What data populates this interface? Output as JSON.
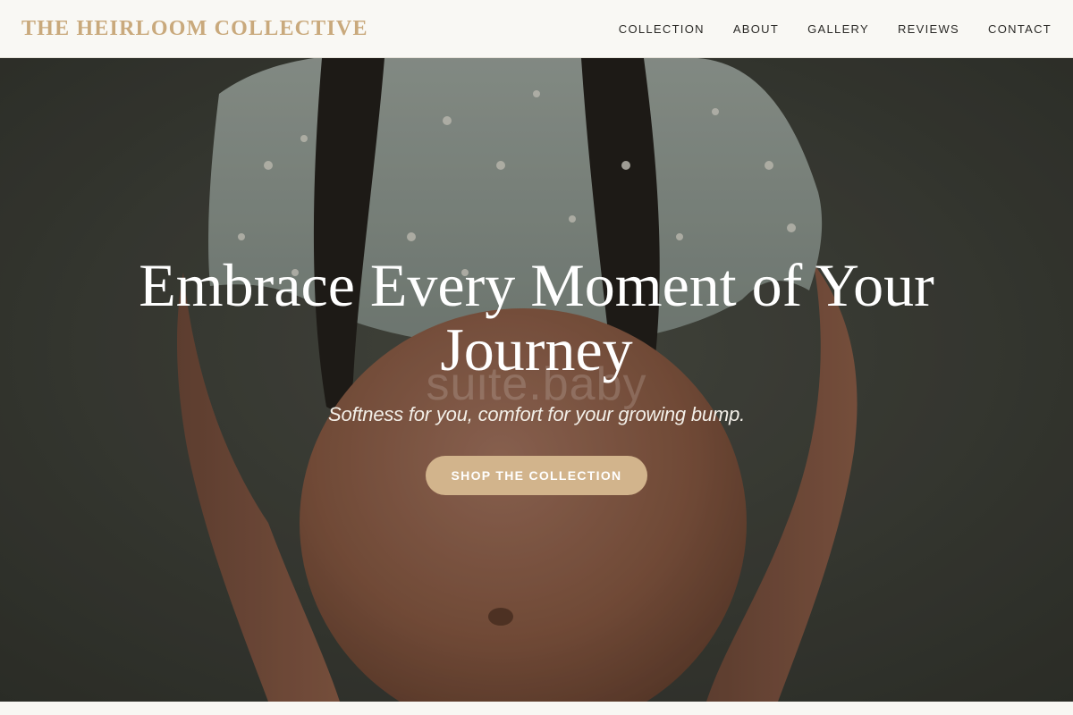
{
  "brand": {
    "name": "THE HEIRLOOM COLLECTIVE",
    "accent_color": "#c9a97c"
  },
  "nav": {
    "items": [
      {
        "label": "COLLECTION"
      },
      {
        "label": "ABOUT"
      },
      {
        "label": "GALLERY"
      },
      {
        "label": "REVIEWS"
      },
      {
        "label": "CONTACT"
      }
    ]
  },
  "hero": {
    "title": "Embrace Every Moment of Your Journey",
    "subtitle": "Softness for you, comfort for your growing bump.",
    "cta_label": "SHOP THE COLLECTION",
    "cta_color": "#d2b48c",
    "watermark": "suite.baby"
  }
}
